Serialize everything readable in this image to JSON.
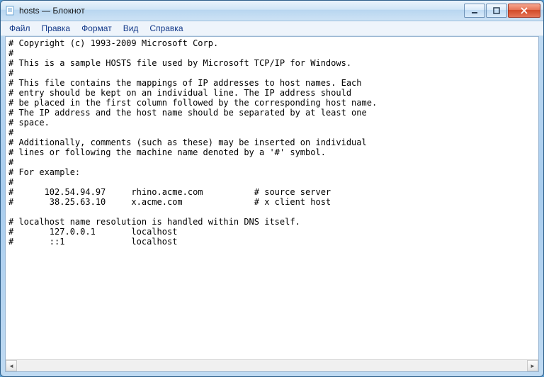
{
  "window": {
    "title": "hosts — Блокнот"
  },
  "menu": {
    "file": "Файл",
    "edit": "Правка",
    "format": "Формат",
    "view": "Вид",
    "help": "Справка"
  },
  "content": "# Copyright (c) 1993-2009 Microsoft Corp.\n#\n# This is a sample HOSTS file used by Microsoft TCP/IP for Windows.\n#\n# This file contains the mappings of IP addresses to host names. Each\n# entry should be kept on an individual line. The IP address should\n# be placed in the first column followed by the corresponding host name.\n# The IP address and the host name should be separated by at least one\n# space.\n#\n# Additionally, comments (such as these) may be inserted on individual\n# lines or following the machine name denoted by a '#' symbol.\n#\n# For example:\n#\n#      102.54.94.97     rhino.acme.com          # source server\n#       38.25.63.10     x.acme.com              # x client host\n\n# localhost name resolution is handled within DNS itself.\n#\t127.0.0.1       localhost\n#\t::1             localhost",
  "scrollbar": {
    "left": "◄",
    "right": "►"
  }
}
